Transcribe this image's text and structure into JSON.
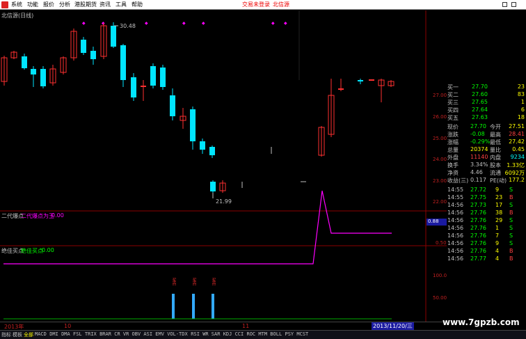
{
  "menu": {
    "items": [
      "系统",
      "功能",
      "报价",
      "分析",
      "港股期货",
      "资讯",
      "工具",
      "帮助"
    ],
    "right_links": [
      "交易未登录",
      "北信源"
    ]
  },
  "main_chart": {
    "title": "北信源(日线)",
    "high_label": "30.48",
    "low_label": "21.99",
    "y_ticks": [
      "27.00",
      "26.00",
      "25.00",
      "24.00",
      "23.00",
      "22.00"
    ]
  },
  "indicator1": {
    "name": "二代爆点",
    "formula_label": "二代爆点为王",
    "value": "0.00",
    "y_ticks": [
      "0.50"
    ],
    "current_value_box": "0.88"
  },
  "indicator2": {
    "name": "绝佳买点",
    "formula_label": "绝佳买点",
    "value": "0.00",
    "y_ticks": [
      "100.0",
      "50.00"
    ],
    "marker_text": "买点"
  },
  "date_axis": {
    "labels": [
      "2013年",
      "10",
      "11"
    ],
    "current_date": "2013/11/20/三"
  },
  "quote_panel": {
    "buy_orders": [
      {
        "label": "买一",
        "price": "27.70",
        "vol": "23"
      },
      {
        "label": "买二",
        "price": "27.60",
        "vol": "83"
      },
      {
        "label": "买三",
        "price": "27.65",
        "vol": "1"
      },
      {
        "label": "买四",
        "price": "27.64",
        "vol": "6"
      },
      {
        "label": "买五",
        "price": "27.63",
        "vol": "18"
      }
    ],
    "stats": [
      {
        "l1": "现价",
        "v1": "27.70",
        "l2": "今开",
        "v2": "27.51"
      },
      {
        "l1": "涨跌",
        "v1": "-0.08",
        "l2": "最高",
        "v2": "28.41"
      },
      {
        "l1": "涨幅",
        "v1": "-0.29%",
        "l2": "最低",
        "v2": "27.42"
      },
      {
        "l1": "总量",
        "v1": "20374",
        "l2": "量比",
        "v2": "0.45"
      },
      {
        "l1": "外盘",
        "v1": "11140",
        "l2": "内盘",
        "v2": "9234"
      },
      {
        "l1": "换手",
        "v1": "3.34%",
        "l2": "股本",
        "v2": "1.33亿"
      },
      {
        "l1": "净资",
        "v1": "4.46",
        "l2": "流通",
        "v2": "6092万"
      },
      {
        "l1": "收益(三)",
        "v1": "0.117",
        "l2": "PE(动)",
        "v2": "177.2"
      }
    ],
    "ticks": [
      {
        "time": "14:55",
        "price": "27.72",
        "vol": "9",
        "side": "S"
      },
      {
        "time": "14:55",
        "price": "27.75",
        "vol": "23",
        "side": "B"
      },
      {
        "time": "14:56",
        "price": "27.73",
        "vol": "17",
        "side": "S"
      },
      {
        "time": "14:56",
        "price": "27.76",
        "vol": "38",
        "side": "B"
      },
      {
        "time": "14:56",
        "price": "27.76",
        "vol": "29",
        "side": "S"
      },
      {
        "time": "14:56",
        "price": "27.76",
        "vol": "1",
        "side": "S"
      },
      {
        "time": "14:56",
        "price": "27.76",
        "vol": "7",
        "side": "S"
      },
      {
        "time": "14:56",
        "price": "27.76",
        "vol": "9",
        "side": "S"
      },
      {
        "time": "14:56",
        "price": "27.76",
        "vol": "4",
        "side": "B"
      },
      {
        "time": "14:56",
        "price": "27.77",
        "vol": "4",
        "side": "B"
      }
    ]
  },
  "bottom_tabs": [
    "指标",
    "模板",
    "全部",
    "MACD",
    "DMI",
    "DMA",
    "FSL",
    "TRIX",
    "BRAR",
    "CR",
    "VR",
    "OBV",
    "ASI",
    "EMV",
    "VOL-TDX",
    "RSI",
    "WR",
    "SAR",
    "KDJ",
    "CCI",
    "ROC",
    "MTM",
    "BOLL",
    "PSY",
    "MCST"
  ],
  "watermark": "www.7gpzb.com",
  "colors": {
    "up": "#ff3030",
    "down": "#00e5ff",
    "magenta": "#ff00ff",
    "green": "#00ff00"
  }
}
